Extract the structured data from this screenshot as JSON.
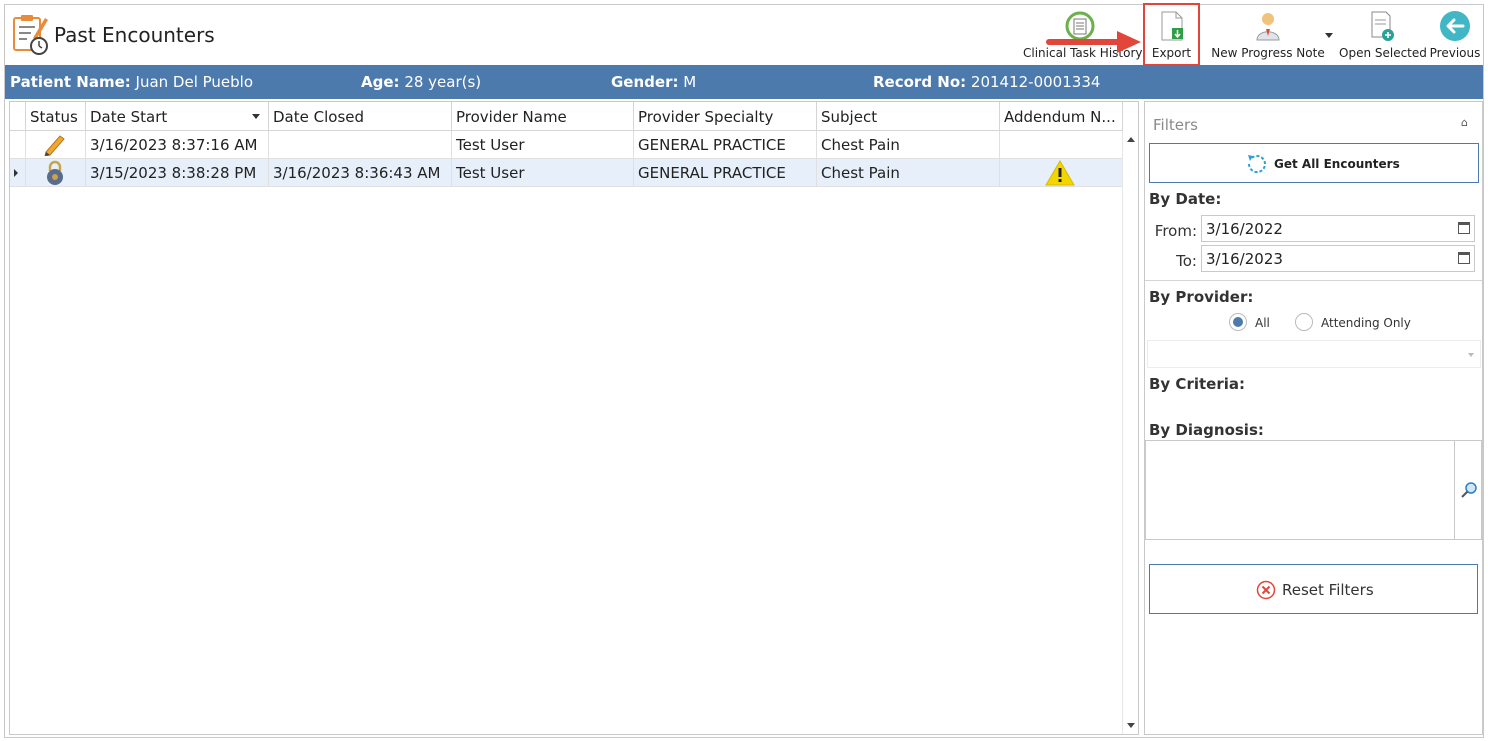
{
  "header": {
    "title": "Past Encounters",
    "toolbar": {
      "clinical_task_history": "Clinical Task History",
      "export": "Export",
      "new_progress_note": "New Progress Note",
      "open_selected": "Open Selected",
      "previous": "Previous"
    }
  },
  "patient": {
    "name_label": "Patient Name:",
    "name": "Juan Del Pueblo",
    "age_label": "Age:",
    "age": "28 year(s)",
    "gender_label": "Gender:",
    "gender": "M",
    "record_label": "Record No:",
    "record": "201412-0001334"
  },
  "grid": {
    "columns": [
      "Status",
      "Date Start",
      "Date Closed",
      "Provider Name",
      "Provider Specialty",
      "Subject",
      "Addendum N..."
    ],
    "rows": [
      {
        "status_icon": "pencil-icon",
        "date_start": "3/16/2023 8:37:16 AM",
        "date_closed": "",
        "provider": "Test User",
        "specialty": "GENERAL PRACTICE",
        "subject": "Chest Pain",
        "addendum_icon": ""
      },
      {
        "status_icon": "lock-icon",
        "date_start": "3/15/2023 8:38:28 PM",
        "date_closed": "3/16/2023 8:36:43 AM",
        "provider": "Test User",
        "specialty": "GENERAL PRACTICE",
        "subject": "Chest Pain",
        "addendum_icon": "warning-icon"
      }
    ]
  },
  "filters": {
    "title": "Filters",
    "get_all": "Get All Encounters",
    "by_date": "By Date:",
    "from_label": "From:",
    "from_value": "3/16/2022",
    "to_label": "To:",
    "to_value": "3/16/2023",
    "by_provider": "By Provider:",
    "radio_all": "All",
    "radio_attending": "Attending Only",
    "by_criteria": "By Criteria:",
    "by_diagnosis": "By Diagnosis:",
    "reset": "Reset Filters"
  },
  "colors": {
    "accent": "#4d7aad",
    "highlight": "#e2463a",
    "selected_row": "#e7f0fa",
    "warning": "#f2d600"
  }
}
